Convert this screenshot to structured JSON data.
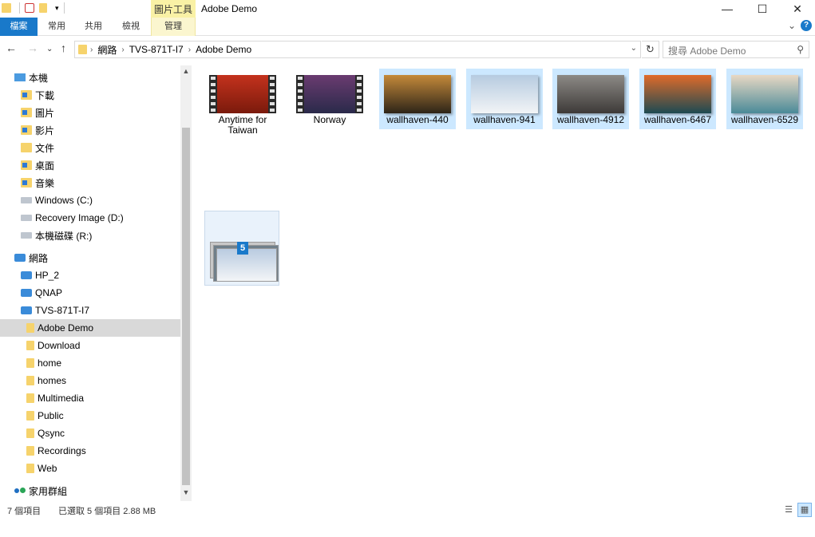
{
  "window": {
    "title": "Adobe Demo",
    "context_tab_title": "圖片工具",
    "minimize_glyph": "—",
    "maximize_glyph": "☐",
    "close_glyph": "✕"
  },
  "ribbon": {
    "tabs": [
      {
        "label": "檔案"
      },
      {
        "label": "常用"
      },
      {
        "label": "共用"
      },
      {
        "label": "檢視"
      },
      {
        "label": "管理"
      }
    ],
    "help_label": "?",
    "collapse_glyph": "⌄"
  },
  "address": {
    "crumbs": [
      "網路",
      "TVS-871T-I7",
      "Adobe Demo"
    ],
    "search_placeholder": "搜尋 Adobe Demo",
    "back_glyph": "←",
    "forward_glyph": "→",
    "up_glyph": "↑",
    "recent_glyph": "⌄",
    "dropdown_glyph": "⌄",
    "refresh_glyph": "↻",
    "search_glyph": "⚲"
  },
  "nav": {
    "this_pc": "本機",
    "items_pc": [
      "下載",
      "圖片",
      "影片",
      "文件",
      "桌面",
      "音樂"
    ],
    "drives": [
      "Windows (C:)",
      "Recovery Image (D:)",
      "本機磁碟 (R:)"
    ],
    "network": "網路",
    "network_hosts": [
      "HP_2",
      "QNAP",
      "TVS-871T-I7"
    ],
    "shares": [
      "Adobe Demo",
      "Download",
      "home",
      "homes",
      "Multimedia",
      "Public",
      "Qsync",
      "Recordings",
      "Web"
    ],
    "homegroup": "家用群組"
  },
  "files": [
    {
      "label": "Anytime for Taiwan",
      "kind": "video",
      "selected": false,
      "colors": [
        "#c4321d",
        "#7a1a0c"
      ]
    },
    {
      "label": "Norway",
      "kind": "video",
      "selected": false,
      "colors": [
        "#6a3b70",
        "#2a2a4a"
      ]
    },
    {
      "label": "wallhaven-440",
      "kind": "image",
      "selected": true,
      "colors": [
        "#c58a3a",
        "#2d2418"
      ]
    },
    {
      "label": "wallhaven-941",
      "kind": "image",
      "selected": true,
      "colors": [
        "#b6cbe0",
        "#f2f4f6"
      ]
    },
    {
      "label": "wallhaven-4912",
      "kind": "image",
      "selected": true,
      "colors": [
        "#8d8a86",
        "#3d3a38"
      ]
    },
    {
      "label": "wallhaven-6467",
      "kind": "image",
      "selected": true,
      "colors": [
        "#e06b2a",
        "#1d4a52"
      ]
    },
    {
      "label": "wallhaven-6529",
      "kind": "image",
      "selected": true,
      "colors": [
        "#e8d8c4",
        "#4a8a98"
      ]
    }
  ],
  "drag_badge": "5",
  "status": {
    "count": "7 個項目",
    "selection": "已選取 5 個項目  2.88 MB"
  },
  "view_buttons": {
    "details": "☰",
    "large": "▦"
  }
}
